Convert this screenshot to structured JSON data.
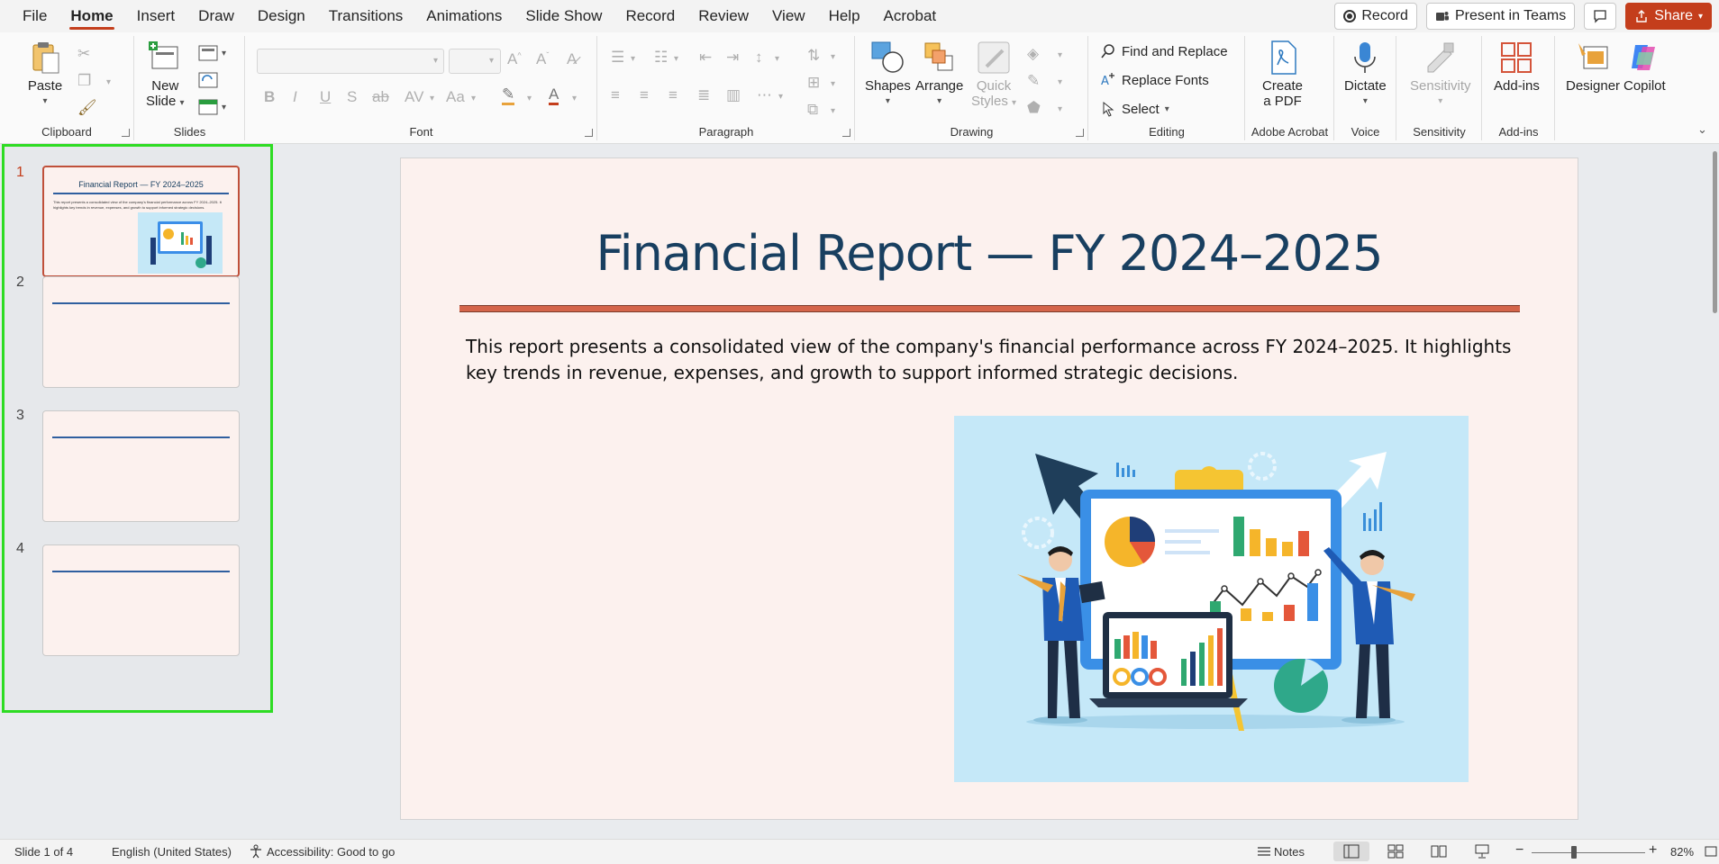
{
  "menu": {
    "tabs": [
      "File",
      "Home",
      "Insert",
      "Draw",
      "Design",
      "Transitions",
      "Animations",
      "Slide Show",
      "Record",
      "Review",
      "View",
      "Help",
      "Acrobat"
    ],
    "active_tab": "Home",
    "record_label": "Record",
    "present_label": "Present in Teams",
    "share_label": "Share"
  },
  "ribbon": {
    "clipboard": {
      "label": "Clipboard",
      "paste": "Paste"
    },
    "slides": {
      "label": "Slides",
      "new_slide_1": "New",
      "new_slide_2": "Slide"
    },
    "font": {
      "label": "Font"
    },
    "paragraph": {
      "label": "Paragraph"
    },
    "drawing": {
      "label": "Drawing",
      "shapes": "Shapes",
      "arrange": "Arrange",
      "quick_styles_1": "Quick",
      "quick_styles_2": "Styles"
    },
    "editing": {
      "label": "Editing",
      "find_replace": "Find and Replace",
      "replace_fonts": "Replace Fonts",
      "select": "Select"
    },
    "acrobat": {
      "label": "Adobe Acrobat",
      "create_pdf_1": "Create",
      "create_pdf_2": "a PDF"
    },
    "voice": {
      "label": "Voice",
      "dictate": "Dictate"
    },
    "sensitivity": {
      "label": "Sensitivity",
      "button": "Sensitivity"
    },
    "addins": {
      "label": "Add-ins",
      "button": "Add-ins"
    },
    "designer": "Designer",
    "copilot": "Copilot"
  },
  "thumbnails": [
    {
      "number": "1",
      "title": "Financial Report — FY 2024–2025",
      "active": true
    },
    {
      "number": "2",
      "title": "",
      "active": false
    },
    {
      "number": "3",
      "title": "",
      "active": false
    },
    {
      "number": "4",
      "title": "",
      "active": false
    }
  ],
  "slide": {
    "title": "Financial Report — FY 2024–2025",
    "body": "This report presents a consolidated view of the company's financial performance across FY 2024–2025. It highlights key trends in revenue, expenses, and growth to support informed strategic decisions."
  },
  "status": {
    "slide_count": "Slide 1 of 4",
    "language": "English (United States)",
    "accessibility": "Accessibility: Good to go",
    "notes": "Notes",
    "zoom": "82%"
  },
  "colors": {
    "accent": "#c43e1c",
    "title": "#183f60",
    "slide_bg": "#fcf1ee",
    "selection_outline": "#2edc23"
  }
}
